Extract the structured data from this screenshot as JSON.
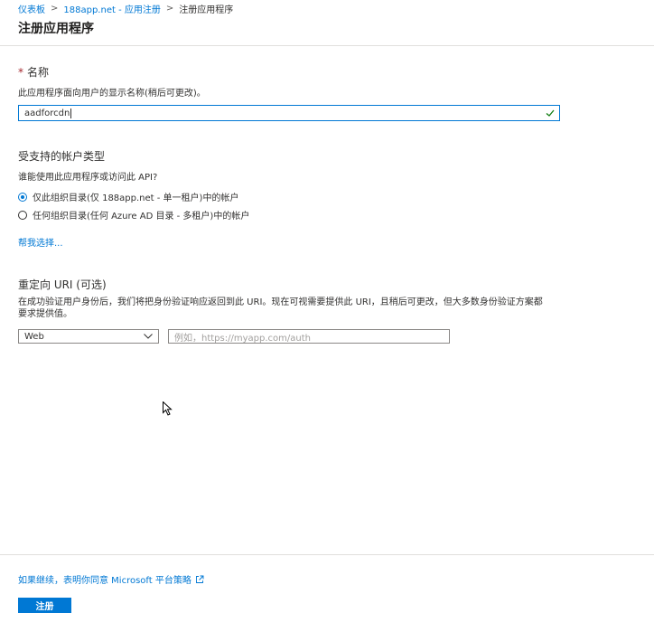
{
  "breadcrumb": {
    "items": [
      "仪表板",
      "188app.net - 应用注册"
    ],
    "current": "注册应用程序"
  },
  "page": {
    "title": "注册应用程序"
  },
  "name_section": {
    "required_mark": "*",
    "heading": "名称",
    "description": "此应用程序面向用户的显示名称(稍后可更改)。",
    "value": "aadforcdn"
  },
  "account_types": {
    "heading": "受支持的帐户类型",
    "question": "谁能使用此应用程序或访问此 API?",
    "options": [
      {
        "label": "仅此组织目录(仅 188app.net - 单一租户)中的帐户",
        "selected": true
      },
      {
        "label": "任何组织目录(任何 Azure AD 目录 - 多租户)中的帐户",
        "selected": false
      }
    ],
    "help_link": "帮我选择..."
  },
  "redirect": {
    "heading": "重定向 URI (可选)",
    "description": "在成功验证用户身份后，我们将把身份验证响应返回到此 URI。现在可视需要提供此 URI，且稍后可更改，但大多数身份验证方案都要求提供值。",
    "platform": "Web",
    "placeholder": "例如，https://myapp.com/auth"
  },
  "footer": {
    "policy_link": "如果继续，表明你同意 Microsoft 平台策略",
    "register_button": "注册"
  },
  "colors": {
    "accent": "#0078d4",
    "required": "#a4262c",
    "valid": "#107c10"
  }
}
